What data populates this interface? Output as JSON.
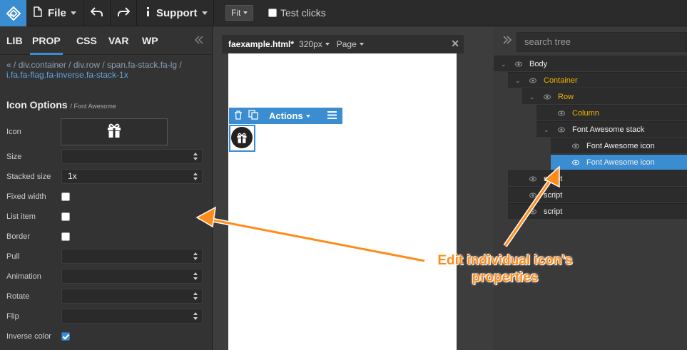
{
  "toolbar": {
    "file_label": "File",
    "support_label": "Support",
    "fit_label": "Fit",
    "test_clicks_label": "Test clicks",
    "test_clicks_checked": false
  },
  "left_panel": {
    "tabs": [
      {
        "label": "LIB",
        "active": false
      },
      {
        "label": "PROP",
        "active": true
      },
      {
        "label": "CSS",
        "active": false
      },
      {
        "label": "VAR",
        "active": false
      },
      {
        "label": "WP",
        "active": false
      }
    ],
    "breadcrumb": {
      "prefix": "« / ",
      "items": [
        "div.container",
        "div.row",
        "span.fa-stack.fa-lg",
        "i.fa.fa-flag.fa-inverse.fa-stack-1x"
      ]
    },
    "section_title": "Icon Options",
    "section_sub": "/ Font Awesome",
    "fields": {
      "icon_label": "Icon",
      "size_label": "Size",
      "size_value": "",
      "stacked_size_label": "Stacked size",
      "stacked_size_value": "1x",
      "fixed_width_label": "Fixed width",
      "fixed_width_checked": false,
      "list_item_label": "List item",
      "list_item_checked": false,
      "border_label": "Border",
      "border_checked": false,
      "pull_label": "Pull",
      "pull_value": "",
      "animation_label": "Animation",
      "animation_value": "",
      "rotate_label": "Rotate",
      "rotate_value": "",
      "flip_label": "Flip",
      "flip_value": "",
      "inverse_color_label": "Inverse color",
      "inverse_color_checked": true
    }
  },
  "canvas": {
    "file_name": "faexample.html*",
    "width_label": "320px",
    "page_label": "Page",
    "actions_label": "Actions"
  },
  "tree": {
    "search_placeholder": "search tree",
    "items": [
      {
        "label": "Body",
        "level": 0,
        "expanded": true,
        "color": "white",
        "selected": false
      },
      {
        "label": "Container",
        "level": 1,
        "expanded": true,
        "color": "yellow",
        "selected": false
      },
      {
        "label": "Row",
        "level": 2,
        "expanded": true,
        "color": "yellow",
        "selected": false
      },
      {
        "label": "Column",
        "level": 3,
        "expanded": false,
        "color": "yellow",
        "selected": false
      },
      {
        "label": "Font Awesome stack",
        "level": 3,
        "expanded": true,
        "color": "white",
        "selected": false
      },
      {
        "label": "Font Awesome icon",
        "level": 4,
        "expanded": false,
        "color": "white",
        "selected": false
      },
      {
        "label": "Font Awesome icon",
        "level": 4,
        "expanded": false,
        "color": "white",
        "selected": true
      },
      {
        "label": "script",
        "level": 1,
        "expanded": false,
        "color": "white",
        "selected": false
      },
      {
        "label": "script",
        "level": 1,
        "expanded": false,
        "color": "white",
        "selected": false
      },
      {
        "label": "script",
        "level": 1,
        "expanded": false,
        "color": "white",
        "selected": false
      }
    ]
  },
  "annotation": {
    "line1": "Edit individual icon's",
    "line2": "properties"
  },
  "colors": {
    "accent": "#3a8dd1",
    "annotation": "#ff8c1a",
    "tree_highlight": "#f0b400"
  }
}
